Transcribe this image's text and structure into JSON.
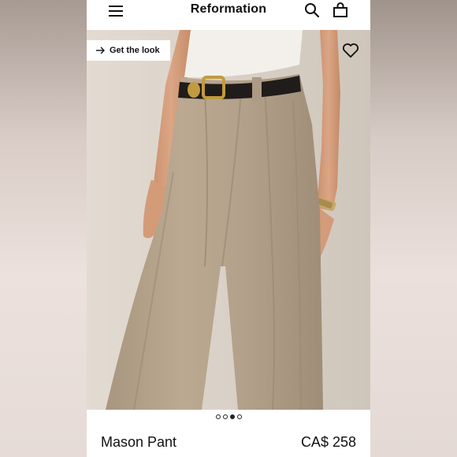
{
  "header": {
    "brand": "Reformation"
  },
  "hero": {
    "get_the_look_label": "Get the look",
    "carousel": {
      "count": 4,
      "active_index": 2
    }
  },
  "product": {
    "name": "Mason Pant",
    "price": "CA$ 258"
  },
  "icons": {
    "menu": "menu-icon",
    "search": "search-icon",
    "bag": "shopping-bag-icon",
    "favorite": "heart-icon",
    "arrow": "arrow-right-icon"
  },
  "colors": {
    "text": "#111111",
    "background": "#ffffff",
    "pant": "#b7a48d",
    "photo_bg": "#d6cec4"
  }
}
